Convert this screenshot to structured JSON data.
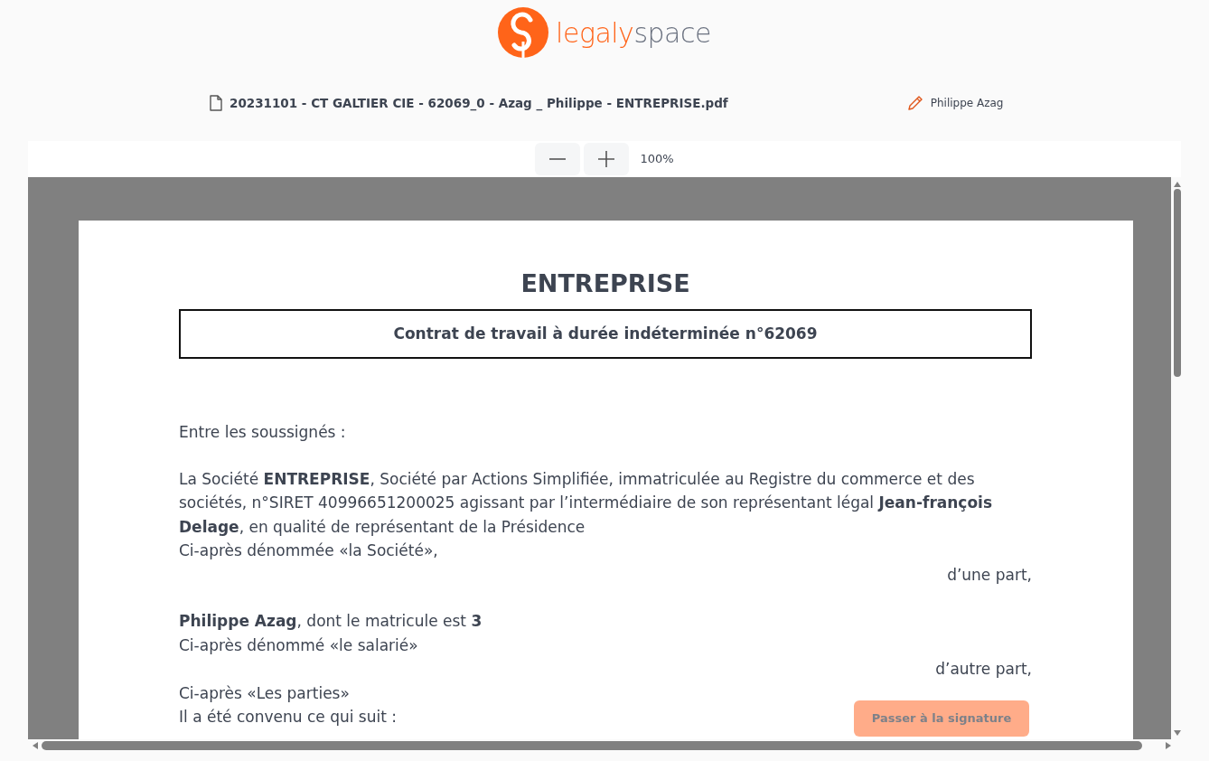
{
  "logo": {
    "parts": [
      {
        "text": "legaly",
        "color": "#ff6419"
      },
      {
        "text": "space",
        "color": "#6b7280"
      }
    ]
  },
  "file": {
    "name": "20231101 - CT GALTIER CIE - 62069_0 - Azag _ Philippe - ENTREPRISE.pdf"
  },
  "signer": {
    "name": "Philippe Azag"
  },
  "zoom": {
    "reading": "100%"
  },
  "document": {
    "title": "ENTREPRISE",
    "subtitle": "Contrat de travail à durée indéterminée n°62069",
    "blocks": [
      {
        "lines": [
          {
            "text": "Entre les soussignés :",
            "right_aligned": false
          }
        ]
      },
      {
        "lines": [
          {
            "text": "La Société **ENTREPRISE**, Société par Actions Simplifiée, immatriculée au Registre du commerce et des sociétés, n°SIRET 40996651200025 agissant par l’intermédiaire de son représentant légal **Jean-françois Delage**, en qualité de représentant de la Présidence",
            "right_aligned": false
          },
          {
            "text": "Ci-après dénommée «la Société»,",
            "right_aligned": false
          },
          {
            "text": "d’une part,",
            "right_aligned": true
          }
        ]
      },
      {
        "lines": [
          {
            "text": "**Philippe Azag**, dont le matricule est **3**",
            "right_aligned": false
          },
          {
            "text": "Ci-après dénommé «le salarié»",
            "right_aligned": false
          },
          {
            "text": "d’autre part,",
            "right_aligned": true
          },
          {
            "text": "Ci-après «Les parties»",
            "right_aligned": false
          },
          {
            "text": "Il a été convenu ce qui suit :",
            "right_aligned": false
          }
        ]
      }
    ]
  },
  "action": {
    "label": "Passer à la signature"
  }
}
